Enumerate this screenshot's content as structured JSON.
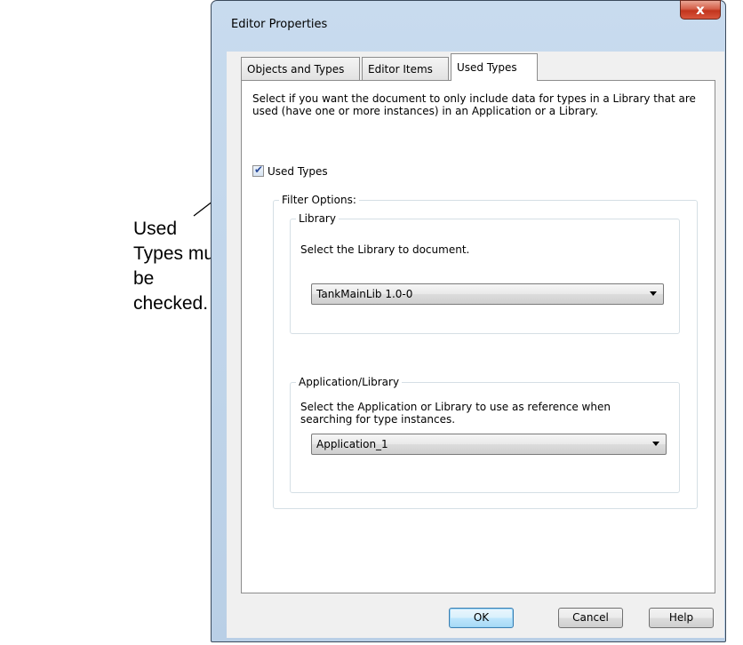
{
  "annotation": {
    "text_line1": "Used Types must",
    "text_line2": "be checked."
  },
  "window": {
    "title": "Editor Properties",
    "close_glyph": "x"
  },
  "tabs": [
    {
      "label": "Objects and Types",
      "active": false
    },
    {
      "label": "Editor Items",
      "active": false
    },
    {
      "label": "Used Types",
      "active": true
    }
  ],
  "used_types_tab": {
    "description": "Select if you want the document to only include data for types in a Library that are used (have one or more instances) in an Application or a Library.",
    "checkbox": {
      "label": "Used Types",
      "checked": true
    },
    "filter_options": {
      "legend": "Filter Options:",
      "library": {
        "legend": "Library",
        "instruction": "Select the Library to document.",
        "selected": "TankMainLib 1.0-0"
      },
      "application_library": {
        "legend": "Application/Library",
        "instruction": "Select the Application or Library to use as reference when searching for type instances.",
        "selected": "Application_1"
      }
    }
  },
  "buttons": {
    "ok": "OK",
    "cancel": "Cancel",
    "help": "Help"
  }
}
